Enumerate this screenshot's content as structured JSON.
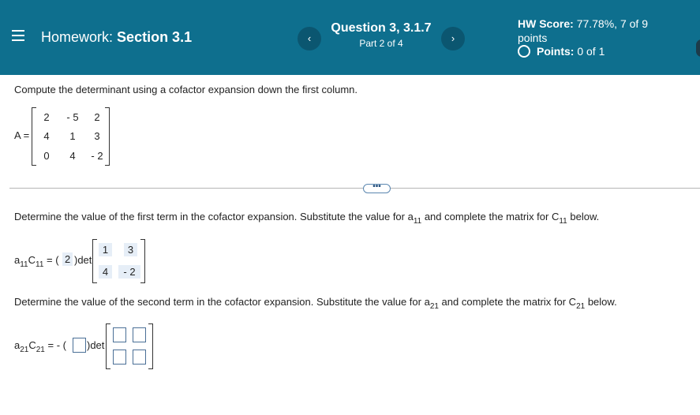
{
  "header": {
    "hw_prefix": "Homework:",
    "hw_section": "Section 3.1",
    "question_title": "Question 3, 3.1.7",
    "question_part": "Part 2 of 4",
    "prev_symbol": "‹",
    "next_symbol": "›",
    "score_label": "HW Score:",
    "score_value": "77.78%, 7 of 9",
    "score_unit": "points",
    "points_label": "Points:",
    "points_value": "0 of 1"
  },
  "problem": {
    "instruction": "Compute the determinant using a cofactor expansion down the first column.",
    "matrix_label": "A =",
    "matrix": [
      [
        "2",
        "- 5",
        "2"
      ],
      [
        "4",
        "1",
        "3"
      ],
      [
        "0",
        "4",
        "- 2"
      ]
    ]
  },
  "more_button_label": "•••",
  "step1": {
    "instruction_a": "Determine the value of the first term in the cofactor expansion. Substitute the value for a",
    "instruction_sub1": "11",
    "instruction_b": " and complete the matrix for C",
    "instruction_sub2": "11",
    "instruction_c": " below.",
    "lhs_a": "a",
    "lhs_sub_a": "11",
    "lhs_c": "C",
    "lhs_sub_c": "11",
    "eq": "= (",
    "coef": "2",
    "det": ")det",
    "matrix": [
      [
        "1",
        "3"
      ],
      [
        "4",
        "- 2"
      ]
    ]
  },
  "step2": {
    "instruction_a": "Determine the value of the second term in the cofactor expansion. Substitute the value for a",
    "instruction_sub1": "21",
    "instruction_b": " and complete the matrix for C",
    "instruction_sub2": "21",
    "instruction_c": " below.",
    "lhs_a": "a",
    "lhs_sub_a": "21",
    "lhs_c": "C",
    "lhs_sub_c": "21",
    "eq": "= - (",
    "det": ")det"
  }
}
